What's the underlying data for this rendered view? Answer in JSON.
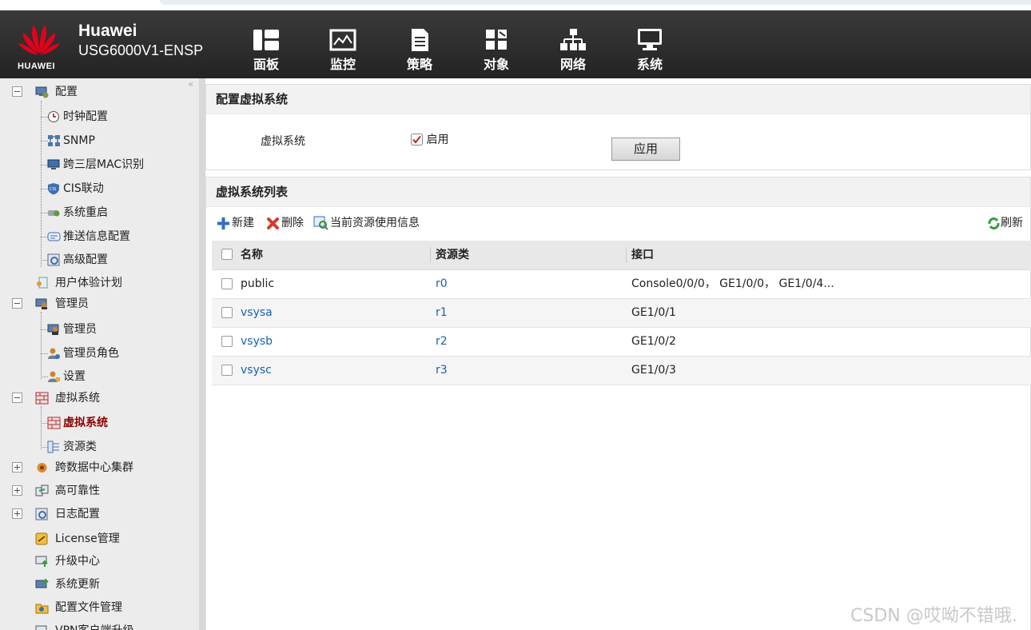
{
  "header": {
    "logo_text": "HUAWEI",
    "brand_line1": "Huawei",
    "brand_line2": "USG6000V1-ENSP",
    "nav": [
      {
        "label": "面板",
        "icon": "dashboard-icon"
      },
      {
        "label": "监控",
        "icon": "monitor-chart-icon"
      },
      {
        "label": "策略",
        "icon": "document-icon"
      },
      {
        "label": "对象",
        "icon": "objects-icon"
      },
      {
        "label": "网络",
        "icon": "network-tree-icon"
      },
      {
        "label": "系统",
        "icon": "computer-icon"
      }
    ]
  },
  "sidebar": {
    "collapse": "«",
    "items": [
      {
        "label": "配置"
      },
      {
        "label": "时钟配置"
      },
      {
        "label": "SNMP"
      },
      {
        "label": "跨三层MAC识别"
      },
      {
        "label": "CIS联动"
      },
      {
        "label": "系统重启"
      },
      {
        "label": "推送信息配置"
      },
      {
        "label": "高级配置"
      },
      {
        "label": "用户体验计划"
      },
      {
        "label": "管理员"
      },
      {
        "label": "管理员"
      },
      {
        "label": "管理员角色"
      },
      {
        "label": "设置"
      },
      {
        "label": "虚拟系统"
      },
      {
        "label": "虚拟系统"
      },
      {
        "label": "资源类"
      },
      {
        "label": "跨数据中心集群"
      },
      {
        "label": "高可靠性"
      },
      {
        "label": "日志配置"
      },
      {
        "label": "License管理"
      },
      {
        "label": "升级中心"
      },
      {
        "label": "系统更新"
      },
      {
        "label": "配置文件管理"
      },
      {
        "label": "VPN客户端升级"
      }
    ]
  },
  "config_panel": {
    "title": "配置虚拟系统",
    "field_label": "虚拟系统",
    "checkbox_label": "启用",
    "checkbox_checked": true,
    "apply_label": "应用"
  },
  "list_panel": {
    "title": "虚拟系统列表",
    "toolbar": {
      "new_label": "新建",
      "delete_label": "删除",
      "usage_label": "当前资源使用信息",
      "refresh_label": "刷新"
    },
    "columns": [
      "名称",
      "资源类",
      "接口"
    ],
    "rows": [
      {
        "name": "public",
        "resource": "r0",
        "interface": "Console0/0/0， GE1/0/0， GE1/0/4..."
      },
      {
        "name": "vsysa",
        "resource": "r1",
        "interface": "GE1/0/1"
      },
      {
        "name": "vsysb",
        "resource": "r2",
        "interface": "GE1/0/2"
      },
      {
        "name": "vsysc",
        "resource": "r3",
        "interface": "GE1/0/3"
      }
    ]
  },
  "watermark": "CSDN @哎呦不错哦."
}
